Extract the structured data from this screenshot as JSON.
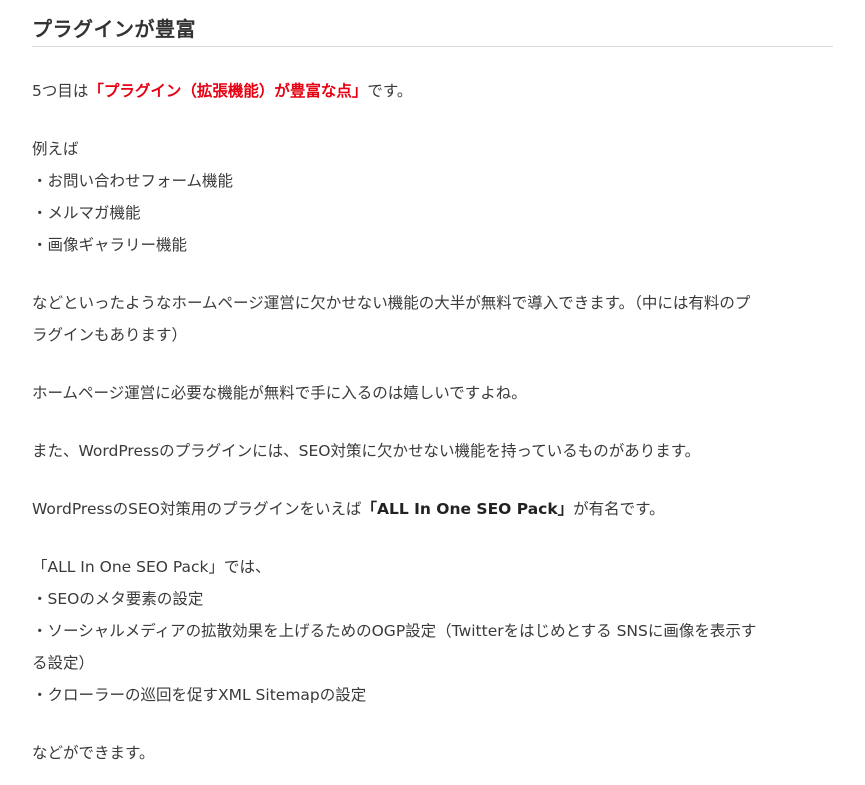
{
  "heading": "プラグインが豊富",
  "p1": {
    "prefix": "5つ目は",
    "highlight": "「プラグイン（拡張機能）が豊富な点」",
    "suffix": "です。",
    "highlight_color": "#e60012"
  },
  "examples": {
    "intro": "例えば",
    "items": [
      "・お問い合わせフォーム機能",
      "・メルマガ機能",
      "・画像ギャラリー機能"
    ]
  },
  "p2": {
    "line1": "などといったようなホームページ運営に欠かせない機能の大半が無料で導入できます。（中には有料のプ",
    "line2": "ラグインもあります）"
  },
  "p3": "ホームページ運営に必要な機能が無料で手に入るのは嬉しいですよね。",
  "p4": "また、WordPressのプラグインには、SEO対策に欠かせない機能を持っているものがあります。",
  "p5": {
    "prefix": "WordPressのSEO対策用のプラグインをいえば",
    "bold": "「ALL In One SEO Pack」",
    "suffix": "が有名です。"
  },
  "features": {
    "intro": "「ALL In One SEO Pack」では、",
    "item1": "・SEOのメタ要素の設定",
    "item2_line1": "・ソーシャルメディアの拡散効果を上げるためのOGP設定（Twitterをはじめとする SNSに画像を表示す",
    "item2_line2": "る設定）",
    "item3": "・クローラーの巡回を促すXML Sitemapの設定"
  },
  "closing": "などができます。"
}
